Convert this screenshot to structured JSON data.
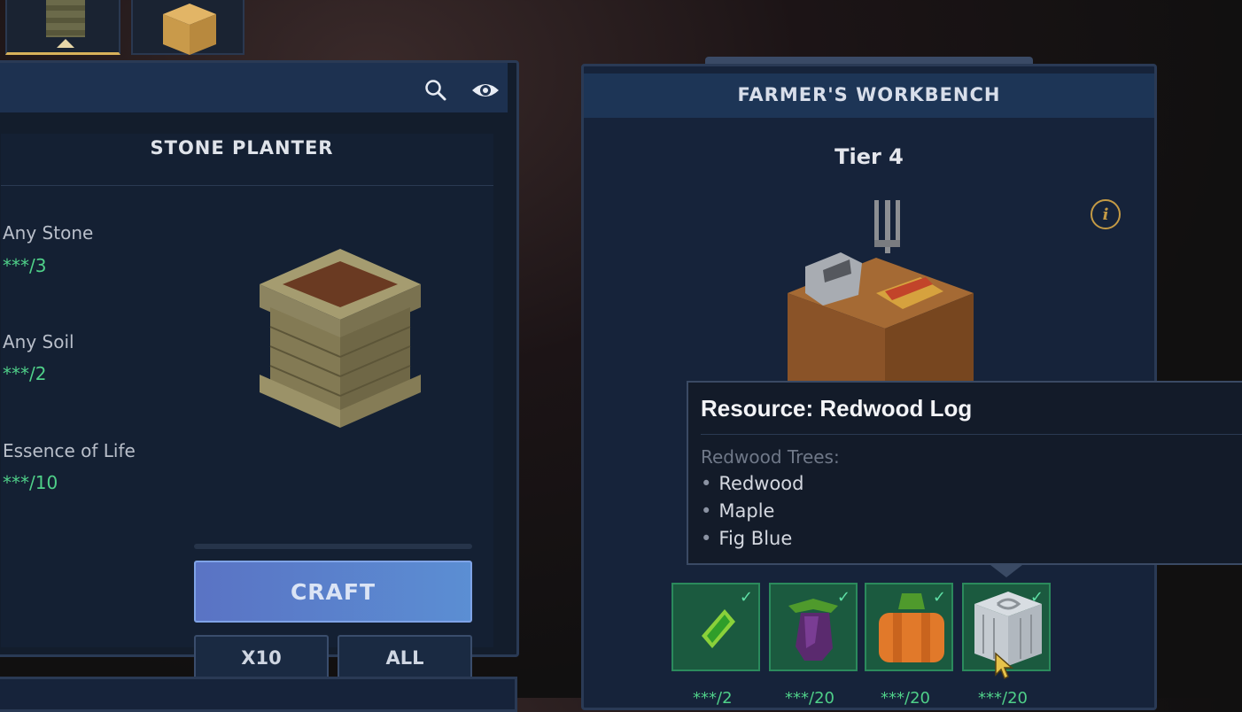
{
  "left_panel": {
    "recipe_title": "STONE PLANTER",
    "ingredients": [
      {
        "name": "Any Stone",
        "count": "***/3"
      },
      {
        "name": "Any Soil",
        "count": "***/2"
      },
      {
        "name": "Essence of Life",
        "count": "***/10"
      }
    ],
    "craft_label": "CRAFT",
    "x10_label": "X10",
    "all_label": "ALL"
  },
  "right_panel": {
    "title": "FARMER'S WORKBENCH",
    "tier": "Tier 4",
    "info_glyph": "i",
    "slots": [
      {
        "icon": "leaf-item-icon",
        "count": "***/2"
      },
      {
        "icon": "eggplant-item-icon",
        "count": "***/20"
      },
      {
        "icon": "pumpkin-item-icon",
        "count": "***/20"
      },
      {
        "icon": "redwood-log-item-icon",
        "count": "***/20"
      }
    ]
  },
  "tooltip": {
    "title": "Resource: Redwood Log",
    "subtitle": "Redwood Trees:",
    "items": [
      "Redwood",
      "Maple",
      "Fig Blue"
    ]
  },
  "colors": {
    "accent_green": "#4fd089",
    "craft_blue": "#5b8ed3",
    "gold": "#c49a45"
  }
}
